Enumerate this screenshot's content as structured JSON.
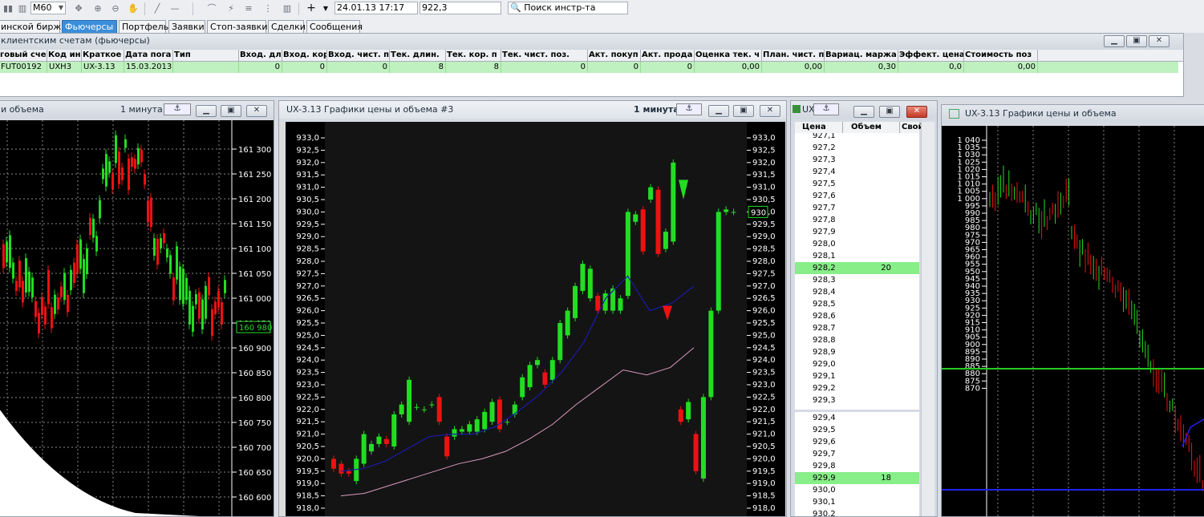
{
  "toolbar": {
    "timeframe": "M60",
    "datetime": "24.01.13 17:17",
    "price": "922,3",
    "search_label": "Поиск инстр-та",
    "icons": [
      "candles-icon",
      "bars-icon",
      "timeframe-dropdown",
      "move-icon",
      "zoom-in-icon",
      "zoom-out-icon",
      "hand-icon",
      "line-icon",
      "hline-icon",
      "arc-icon",
      "fib-icon",
      "grid-icon",
      "crosshair-icon",
      "dropdown-arrow-icon",
      "search-icon"
    ]
  },
  "tabs": [
    "инской бирж и",
    "Фьючерсы",
    "Портфель",
    "Заявки",
    "Стоп-заявки",
    "Сделки",
    "Сообщения"
  ],
  "futures_window": {
    "title": "клиентским счетам (фьючерсы)",
    "columns": [
      "говый сче",
      "Код ин",
      "Краткое",
      "Дата пога",
      "Тип",
      "Вход. дл",
      "Вход. кор",
      "Вход. чист. п",
      "Тек. длин.",
      "Тек. кор. п",
      "Тек. чист. поз.",
      "Акт. покуп",
      "Акт. прода",
      "Оценка тек. ч",
      "План. чист. п",
      "Вариац. маржа",
      "Эффект. цена",
      "Стоимость поз"
    ],
    "row": [
      "FUT00192",
      "UXH3",
      "UX-3.13",
      "15.03.2013",
      "",
      "0",
      "0",
      "0",
      "8",
      "8",
      "0",
      "0",
      "0",
      "0,00",
      "0,00",
      "0,30",
      "0,0",
      "0,00"
    ]
  },
  "left_chart": {
    "title": "и объема",
    "interval": "1 минута",
    "price_labels": [
      "161 300",
      "161 250",
      "161 200",
      "161 150",
      "161 100",
      "161 050",
      "161 000",
      "160 950",
      "160 900",
      "160 850",
      "160 800",
      "160 750",
      "160 700",
      "160 650",
      "160 600"
    ],
    "current_price": "160 980"
  },
  "center_chart": {
    "title": "UX-3.13 Графики цены и объема #3",
    "interval": "1 минута",
    "price_labels": [
      "933,0",
      "932,5",
      "932,0",
      "931,5",
      "931,0",
      "930,5",
      "930,0",
      "929,5",
      "929,0",
      "928,5",
      "928,0",
      "927,5",
      "927,0",
      "926,5",
      "926,0",
      "925,5",
      "925,0",
      "924,5",
      "924,0",
      "923,5",
      "923,0",
      "922,5",
      "922,0",
      "921,5",
      "921,0",
      "920,5",
      "920,0",
      "919,5",
      "919,0",
      "918,5",
      "918,0"
    ],
    "current_price": "930",
    "chart_data": {
      "type": "candlestick",
      "ylim": [
        918.0,
        933.0
      ],
      "candles": [
        {
          "o": 920.0,
          "c": 919.6
        },
        {
          "o": 919.8,
          "c": 919.4
        },
        {
          "o": 919.5,
          "c": 919.4
        },
        {
          "o": 919.1,
          "c": 920.0
        },
        {
          "o": 919.8,
          "c": 921.0
        },
        {
          "o": 920.3,
          "c": 920.6
        },
        {
          "o": 920.6,
          "c": 920.9
        },
        {
          "o": 920.8,
          "c": 920.6
        },
        {
          "o": 920.5,
          "c": 921.8
        },
        {
          "o": 921.8,
          "c": 922.2
        },
        {
          "o": 921.5,
          "c": 923.2
        },
        {
          "o": 922.1,
          "c": 922.1
        },
        {
          "o": 922.0,
          "c": 922.0
        },
        {
          "o": 922.2,
          "c": 922.2
        },
        {
          "o": 922.5,
          "c": 921.5
        },
        {
          "o": 920.9,
          "c": 920.1
        },
        {
          "o": 920.9,
          "c": 921.2
        },
        {
          "o": 921.1,
          "c": 921.2
        },
        {
          "o": 921.1,
          "c": 921.4
        },
        {
          "o": 921.1,
          "c": 921.6
        },
        {
          "o": 921.2,
          "c": 921.9
        },
        {
          "o": 921.5,
          "c": 922.3
        },
        {
          "o": 922.4,
          "c": 921.2
        },
        {
          "o": 921.5,
          "c": 921.5
        },
        {
          "o": 921.8,
          "c": 922.2
        },
        {
          "o": 922.5,
          "c": 923.3
        },
        {
          "o": 922.9,
          "c": 923.8
        },
        {
          "o": 923.8,
          "c": 924.0
        },
        {
          "o": 923.5,
          "c": 923.0
        },
        {
          "o": 923.2,
          "c": 924.0
        },
        {
          "o": 924.0,
          "c": 925.5
        },
        {
          "o": 925.0,
          "c": 926.0
        },
        {
          "o": 925.7,
          "c": 927.0
        },
        {
          "o": 926.8,
          "c": 927.9
        },
        {
          "o": 926.5,
          "c": 927.7
        },
        {
          "o": 926.6,
          "c": 926.0
        },
        {
          "o": 926.0,
          "c": 926.7
        },
        {
          "o": 926.0,
          "c": 926.9
        },
        {
          "o": 926.0,
          "c": 926.5
        },
        {
          "o": 926.6,
          "c": 930.0
        },
        {
          "o": 929.6,
          "c": 929.9
        },
        {
          "o": 930.1,
          "c": 928.4
        },
        {
          "o": 930.5,
          "c": 931.0
        },
        {
          "o": 930.9,
          "c": 928.3
        },
        {
          "o": 928.5,
          "c": 929.2
        },
        {
          "o": 928.8,
          "c": 932.0
        },
        {
          "o": 922.0,
          "c": 921.5
        },
        {
          "o": 921.6,
          "c": 922.3
        },
        {
          "o": 921.0,
          "c": 919.5
        },
        {
          "o": 919.2,
          "c": 922.5
        },
        {
          "o": 922.5,
          "c": 926.0
        },
        {
          "o": 926.0,
          "c": 930.0
        },
        {
          "o": 930.0,
          "c": 930.1
        },
        {
          "o": 930.0,
          "c": 930.0
        }
      ],
      "ma_blue": [
        919.5,
        919.6,
        919.9,
        920.4,
        920.9,
        921.0,
        921.0,
        921.3,
        921.9,
        922.6,
        923.5,
        924.7,
        926.5,
        927.4,
        926.0,
        926.3,
        927.0
      ],
      "ma_pink": [
        918.5,
        918.6,
        918.9,
        919.2,
        919.5,
        919.8,
        920.0,
        920.3,
        920.8,
        921.4,
        922.2,
        922.9,
        923.6,
        923.4,
        923.7,
        924.5
      ]
    }
  },
  "order_book": {
    "title": "UX",
    "columns": [
      "Цена",
      "Объем",
      "Свой"
    ],
    "top_rows": [
      {
        "p": "927,1",
        "v": ""
      },
      {
        "p": "927,2",
        "v": ""
      },
      {
        "p": "927,3",
        "v": ""
      },
      {
        "p": "927,4",
        "v": ""
      },
      {
        "p": "927,5",
        "v": ""
      },
      {
        "p": "927,6",
        "v": ""
      },
      {
        "p": "927,7",
        "v": ""
      },
      {
        "p": "927,8",
        "v": ""
      },
      {
        "p": "927,9",
        "v": ""
      },
      {
        "p": "928,0",
        "v": ""
      },
      {
        "p": "928,1",
        "v": ""
      },
      {
        "p": "928,2",
        "v": "20"
      },
      {
        "p": "928,3",
        "v": ""
      },
      {
        "p": "928,4",
        "v": ""
      },
      {
        "p": "928,5",
        "v": ""
      },
      {
        "p": "928,6",
        "v": ""
      },
      {
        "p": "928,7",
        "v": ""
      },
      {
        "p": "928,8",
        "v": ""
      },
      {
        "p": "928,9",
        "v": ""
      },
      {
        "p": "929,0",
        "v": ""
      },
      {
        "p": "929,1",
        "v": ""
      },
      {
        "p": "929,2",
        "v": ""
      },
      {
        "p": "929,3",
        "v": ""
      }
    ],
    "bottom_rows": [
      {
        "p": "929,4",
        "v": ""
      },
      {
        "p": "929,5",
        "v": ""
      },
      {
        "p": "929,6",
        "v": ""
      },
      {
        "p": "929,7",
        "v": ""
      },
      {
        "p": "929,8",
        "v": ""
      },
      {
        "p": "929,9",
        "v": "18"
      },
      {
        "p": "930,0",
        "v": ""
      },
      {
        "p": "930,1",
        "v": ""
      },
      {
        "p": "930,2",
        "v": ""
      }
    ]
  },
  "right_chart": {
    "title": "UX-3.13 Графики цены и объема",
    "price_labels": [
      "1 040",
      "1 035",
      "1 030",
      "1 025",
      "1 020",
      "1 015",
      "1 010",
      "1 005",
      "1 000",
      "995",
      "990",
      "985",
      "980",
      "975",
      "970",
      "965",
      "960",
      "955",
      "950",
      "945",
      "940",
      "935",
      "930",
      "925",
      "920",
      "915",
      "910",
      "905",
      "900",
      "895",
      "890",
      "885",
      "880",
      "875",
      "870"
    ]
  },
  "colors": {
    "up": "#22dd22",
    "down": "#ee1111",
    "ma_blue": "#1a1aaa",
    "ma_pink": "#d89aba",
    "hline_green": "#22cc22",
    "hline_blue": "#2222ee"
  }
}
